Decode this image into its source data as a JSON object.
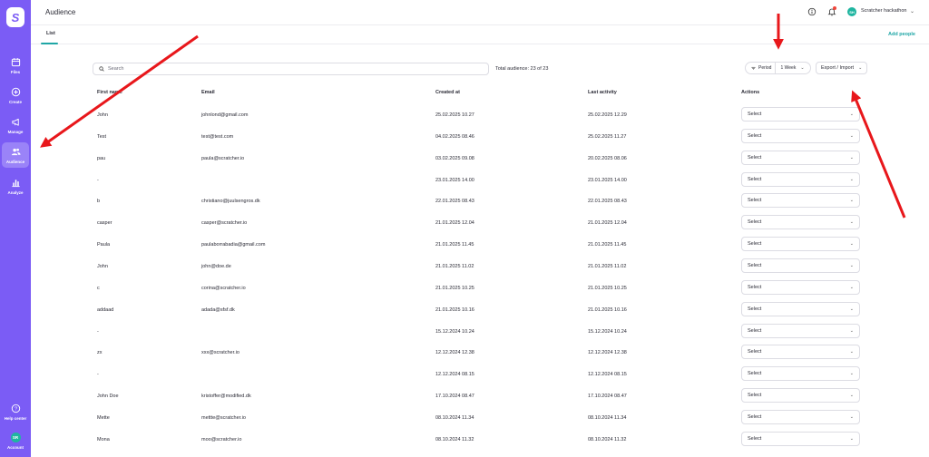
{
  "sidebar": {
    "logo": "S",
    "items": [
      {
        "label": "Files",
        "icon": "calendar-icon"
      },
      {
        "label": "Create",
        "icon": "plus-circle-icon"
      },
      {
        "label": "Manage",
        "icon": "megaphone-icon"
      },
      {
        "label": "Audience",
        "icon": "people-icon",
        "active": true
      },
      {
        "label": "Analyze",
        "icon": "bar-chart-icon"
      }
    ],
    "help_label": "Help center",
    "account_label": "Account",
    "account_initials": "SR"
  },
  "header": {
    "title": "Audience",
    "user_initials": "SH",
    "user_name": "Scratcher hackathon"
  },
  "tabs": {
    "list_label": "List",
    "add_people_label": "Add people"
  },
  "toolbar": {
    "search_placeholder": "Search",
    "total_text": "Total audience: 23 of 23",
    "period_label": "Period",
    "period_value": "1 Week",
    "export_label": "Export / Import"
  },
  "table": {
    "columns": [
      "First name",
      "Email",
      "Created at",
      "Last activity",
      "Actions"
    ],
    "select_label": "Select",
    "rows": [
      [
        "John",
        "johnlond@gmail.com",
        "25.02.2025 10.27",
        "25.02.2025 12.29"
      ],
      [
        "Test",
        "test@test.com",
        "04.02.2025 08.46",
        "25.02.2025 11.27"
      ],
      [
        "pau",
        "paula@scratcher.io",
        "03.02.2025 09.08",
        "20.02.2025 08.06"
      ],
      [
        "-",
        "",
        "23.01.2025 14.00",
        "23.01.2025 14.00"
      ],
      [
        "b",
        "christiano@juulsengros.dk",
        "22.01.2025 08.43",
        "22.01.2025 08.43"
      ],
      [
        "casper",
        "casper@scratcher.io",
        "21.01.2025 12.04",
        "21.01.2025 12.04"
      ],
      [
        "Paula",
        "paulaborrabadia@gmail.com",
        "21.01.2025 11.45",
        "21.01.2025 11.45"
      ],
      [
        "John",
        "john@doe.de",
        "21.01.2025 11.02",
        "21.01.2025 11.02"
      ],
      [
        "c",
        "corina@scratcher.io",
        "21.01.2025 10.25",
        "21.01.2025 10.25"
      ],
      [
        "addaad",
        "adada@sfsf.dk",
        "21.01.2025 10.16",
        "21.01.2025 10.16"
      ],
      [
        "-",
        "",
        "15.12.2024 10.24",
        "15.12.2024 10.24"
      ],
      [
        "zx",
        "xxx@scratcher.io",
        "12.12.2024 12.38",
        "12.12.2024 12.38"
      ],
      [
        "-",
        "",
        "12.12.2024 08.15",
        "12.12.2024 08.15"
      ],
      [
        "John Doe",
        "kristoffer@modified.dk",
        "17.10.2024 08.47",
        "17.10.2024 08.47"
      ],
      [
        "Mette",
        "mettte@scratcher.io",
        "08.10.2024 11.34",
        "08.10.2024 11.34"
      ],
      [
        "Mona",
        "moo@scratcher.io",
        "08.10.2024 11.32",
        "08.10.2024 11.32"
      ]
    ]
  },
  "colors": {
    "sidebar": "#7b5cf5",
    "accent": "#1fa6a6",
    "annotation_arrow": "#e8171b"
  }
}
